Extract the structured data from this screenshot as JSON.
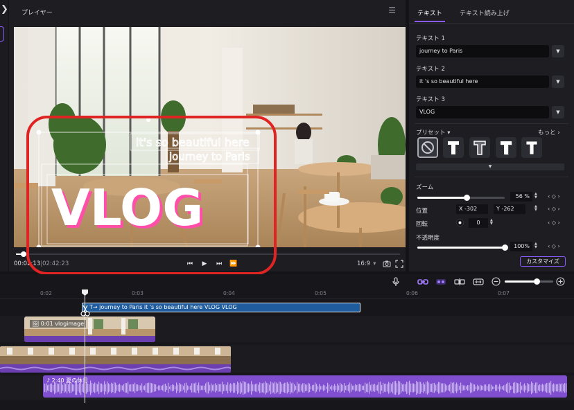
{
  "player": {
    "title": "プレイヤー",
    "overlay": {
      "line1": "it's so beautiful here",
      "line2": "journey to Paris",
      "main": "VLOG"
    },
    "progress": 0.02,
    "time_current": "00:02:13",
    "time_sep": "|",
    "time_total": "02:42:23",
    "aspect_ratio": "16:9"
  },
  "panel": {
    "tabs": [
      "テキスト",
      "テキスト読み上げ"
    ],
    "text1": {
      "label": "テキスト 1",
      "value": "journey to Paris"
    },
    "text2": {
      "label": "テキスト 2",
      "value": "it 's so beautiful here"
    },
    "text3": {
      "label": "テキスト 3",
      "value": "VLOG"
    },
    "preset": {
      "label": "プリセット",
      "more": "もっと"
    },
    "zoom": {
      "label": "ズーム",
      "value": "56",
      "unit": "%",
      "level": 0.56
    },
    "position": {
      "label": "位置",
      "x_label": "X",
      "x": "-302",
      "y_label": "Y",
      "y": "-262"
    },
    "rotation": {
      "label": "回転",
      "value": "0"
    },
    "opacity": {
      "label": "不透明度",
      "value": "100%",
      "level": 1.0
    },
    "customize": "カスタマイズ"
  },
  "timeline": {
    "ruler": [
      "0:02",
      "0:03",
      "0:04",
      "0:05",
      "0:06",
      "0:07"
    ],
    "text_clip": "journey to Paris it  's so beautiful here  VLOG VLOG",
    "image_clip": "0:01 vlogimage",
    "audio_clip": "2:40 夏の休日",
    "zoom_level": 0.65
  },
  "colors": {
    "accent": "#8a5cff",
    "highlight_ring": "#e02424",
    "text_clip": "#1f5c9e",
    "media_clip": "#6b3fb0"
  }
}
